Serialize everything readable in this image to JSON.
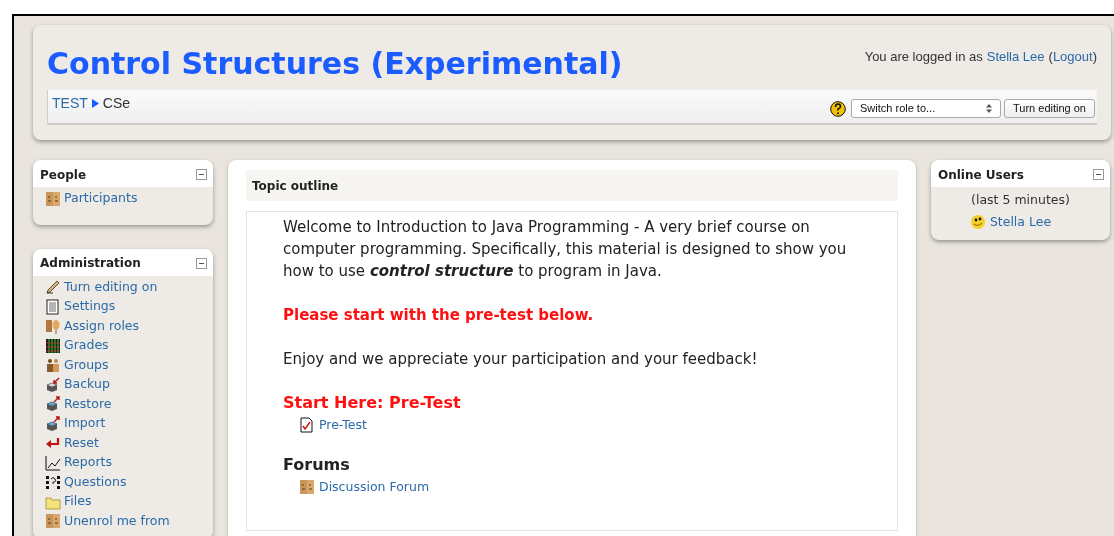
{
  "header": {
    "title": "Control Structures (Experimental)",
    "login": {
      "prefix": "You are logged in as",
      "user": "Stella Lee",
      "open": "(",
      "logout": "Logout",
      "close": ")"
    },
    "breadcrumb": [
      {
        "label": "TEST",
        "link": true
      },
      {
        "label": "CSe",
        "link": false
      }
    ],
    "role_select": "Switch role to...",
    "edit_button": "Turn editing on"
  },
  "left_blocks": [
    {
      "title": "People",
      "items": [
        "Participants"
      ]
    },
    {
      "title": "Administration",
      "items": [
        "Turn editing on",
        "Settings",
        "Assign roles",
        "Grades",
        "Groups",
        "Backup",
        "Restore",
        "Import",
        "Reset",
        "Reports",
        "Questions",
        "Files",
        "Unenrol me from"
      ]
    }
  ],
  "content": {
    "title": "Topic outline",
    "items": [
      {
        "kind": "paragraph",
        "text": "Welcome to Introduction to Java Programming - A very brief course on computer programming. Specifically, this material is designed to show you how to use **control structure** to program in Java.",
        "highlighted": false
      },
      {
        "kind": "paragraph",
        "text": "**Please start with the pre-test below.**",
        "highlighted": true
      },
      {
        "kind": "paragraph",
        "text": "Enjoy and we appreciate your participation and your feedback!",
        "highlighted": false
      },
      {
        "kind": "heading",
        "text": "**Start Here: Pre-Test**",
        "highlighted": true
      },
      {
        "kind": "activity",
        "text": "Pre-Test"
      },
      {
        "kind": "heading",
        "text": "**Forums**",
        "highlighted": false
      },
      {
        "kind": "activity",
        "text": "Discussion Forum"
      }
    ]
  },
  "right_block": {
    "title": "Online Users",
    "note": "(last 5 minutes)",
    "users": [
      "Stella Lee"
    ]
  }
}
